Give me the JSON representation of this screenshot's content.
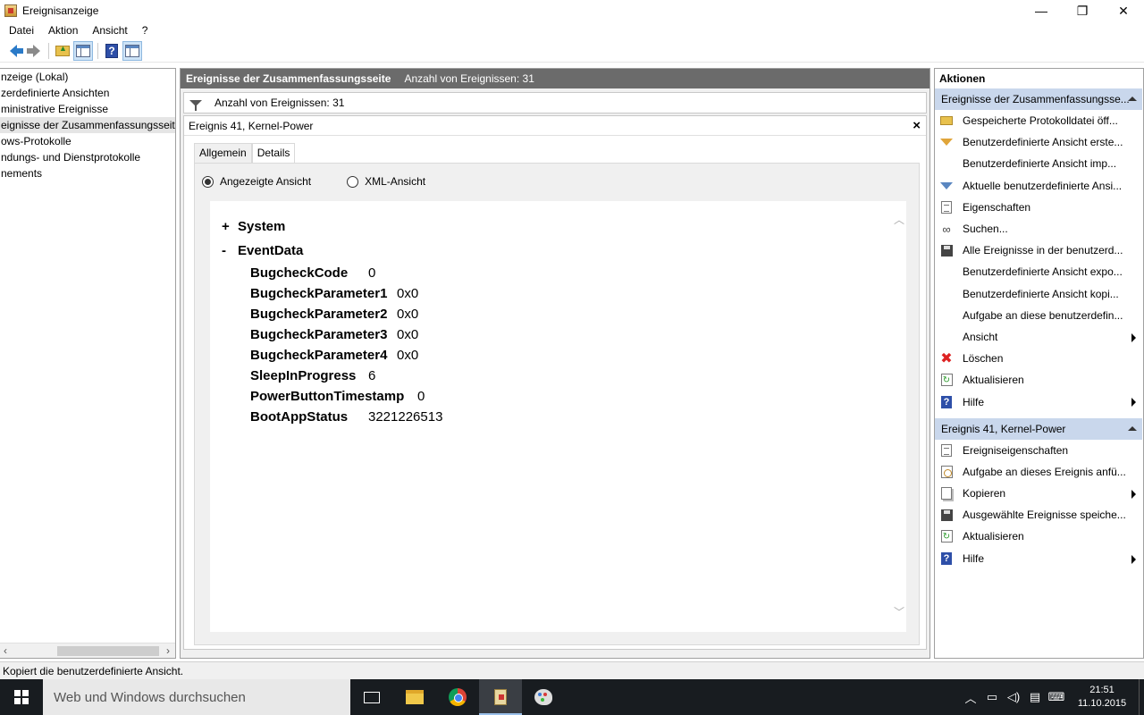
{
  "window": {
    "title": "Ereignisanzeige",
    "minimize": "—",
    "maximize": "❐",
    "close": "✕"
  },
  "menu": [
    "Datei",
    "Aktion",
    "Ansicht",
    "?"
  ],
  "tree": {
    "items": [
      "nzeige (Lokal)",
      "zerdefinierte Ansichten",
      "ministrative Ereignisse",
      "eignisse der Zusammenfassungsseite",
      "ows-Protokolle",
      "ndungs- und Dienstprotokolle",
      "nements"
    ],
    "selected_index": 3
  },
  "middle": {
    "header_title": "Ereignisse der Zusammenfassungsseite",
    "header_count": "Anzahl von Ereignissen: 31",
    "filter_text": "Anzahl von Ereignissen: 31",
    "event_title": "Ereignis 41, Kernel-Power",
    "tabs": [
      "Allgemein",
      "Details"
    ],
    "active_tab": "Details",
    "radio_friendly": "Angezeigte Ansicht",
    "radio_xml": "XML-Ansicht",
    "sections": [
      {
        "sign": "+",
        "label": "System"
      },
      {
        "sign": "-",
        "label": "EventData"
      }
    ],
    "event_data": [
      {
        "key": "BugcheckCode",
        "value": "0"
      },
      {
        "key": "BugcheckParameter1",
        "value": "0x0"
      },
      {
        "key": "BugcheckParameter2",
        "value": "0x0"
      },
      {
        "key": "BugcheckParameter3",
        "value": "0x0"
      },
      {
        "key": "BugcheckParameter4",
        "value": "0x0"
      },
      {
        "key": "SleepInProgress",
        "value": "6"
      },
      {
        "key": "PowerButtonTimestamp",
        "value": "0"
      },
      {
        "key": "BootAppStatus",
        "value": "3221226513"
      }
    ]
  },
  "actions": {
    "title": "Aktionen",
    "section1": {
      "label": "Ereignisse der Zusammenfassungsse...",
      "items": [
        {
          "label": "Gespeicherte Protokolldatei öff...",
          "icon": "folder-icon"
        },
        {
          "label": "Benutzerdefinierte Ansicht erste...",
          "icon": "funnel-icon"
        },
        {
          "label": "Benutzerdefinierte Ansicht imp...",
          "icon": ""
        },
        {
          "label": "Aktuelle benutzerdefinierte Ansi...",
          "icon": "filter-icon"
        },
        {
          "label": "Eigenschaften",
          "icon": "properties-icon"
        },
        {
          "label": "Suchen...",
          "icon": "binoculars-icon"
        },
        {
          "label": "Alle Ereignisse in der benutzerd...",
          "icon": "save-icon"
        },
        {
          "label": "Benutzerdefinierte Ansicht expo...",
          "icon": ""
        },
        {
          "label": "Benutzerdefinierte Ansicht kopi...",
          "icon": ""
        },
        {
          "label": "Aufgabe an diese benutzerdefin...",
          "icon": ""
        },
        {
          "label": "Ansicht",
          "icon": "",
          "submenu": true
        },
        {
          "label": "Löschen",
          "icon": "delete-icon"
        },
        {
          "label": "Aktualisieren",
          "icon": "refresh-icon"
        },
        {
          "label": "Hilfe",
          "icon": "help-icon",
          "submenu": true
        }
      ]
    },
    "section2": {
      "label": "Ereignis 41, Kernel-Power",
      "items": [
        {
          "label": "Ereigniseigenschaften",
          "icon": "properties-icon"
        },
        {
          "label": "Aufgabe an dieses Ereignis anfü...",
          "icon": "task-icon"
        },
        {
          "label": "Kopieren",
          "icon": "copy-icon",
          "submenu": true
        },
        {
          "label": "Ausgewählte Ereignisse speiche...",
          "icon": "save-icon"
        },
        {
          "label": "Aktualisieren",
          "icon": "refresh-icon"
        },
        {
          "label": "Hilfe",
          "icon": "help-icon",
          "submenu": true
        }
      ]
    }
  },
  "status": "Kopiert die benutzerdefinierte Ansicht.",
  "taskbar": {
    "search_placeholder": "Web und Windows durchsuchen",
    "time": "21:51",
    "date": "11.10.2015"
  },
  "colors": {
    "header_bg": "#6b6b6b",
    "section_bg": "#c9d7ec",
    "taskbar_bg": "#181c20"
  }
}
